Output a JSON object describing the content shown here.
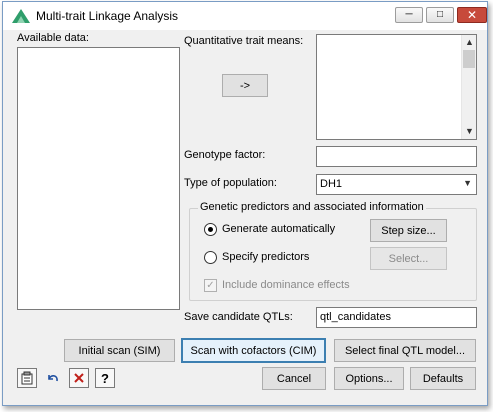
{
  "window": {
    "title": "Multi-trait Linkage Analysis",
    "minimize_glyph": "─",
    "maximize_glyph": "□",
    "close_glyph": "✕"
  },
  "available_data": {
    "label": "Available data:"
  },
  "quantitative": {
    "label": "Quantitative trait means:",
    "move_label": "->"
  },
  "genotype_factor": {
    "label": "Genotype factor:",
    "value": ""
  },
  "population": {
    "label": "Type of population:",
    "value": "DH1"
  },
  "predictors_group": {
    "title": "Genetic predictors and associated information",
    "generate_label": "Generate automatically",
    "generate_selected": true,
    "step_size_label": "Step size...",
    "specify_label": "Specify predictors",
    "select_label": "Select...",
    "dominance_label": "Include dominance effects",
    "dominance_checked": true
  },
  "candidate_qtls": {
    "label": "Save candidate QTLs:",
    "value": "qtl_candidates"
  },
  "buttons": {
    "initial_scan": "Initial scan (SIM)",
    "scan_cofactors": "Scan with cofactors (CIM)",
    "select_final": "Select final QTL model...",
    "cancel": "Cancel",
    "options": "Options...",
    "defaults": "Defaults"
  },
  "toolbar": {
    "copy_icon": "clipboard-icon",
    "undo_icon": "undo-icon",
    "clear_icon": "clear-icon",
    "help_glyph": "?"
  },
  "colors": {
    "accent": "#3c7fb1",
    "close": "#c74a3b",
    "app_icon": "#2f9e6b"
  }
}
